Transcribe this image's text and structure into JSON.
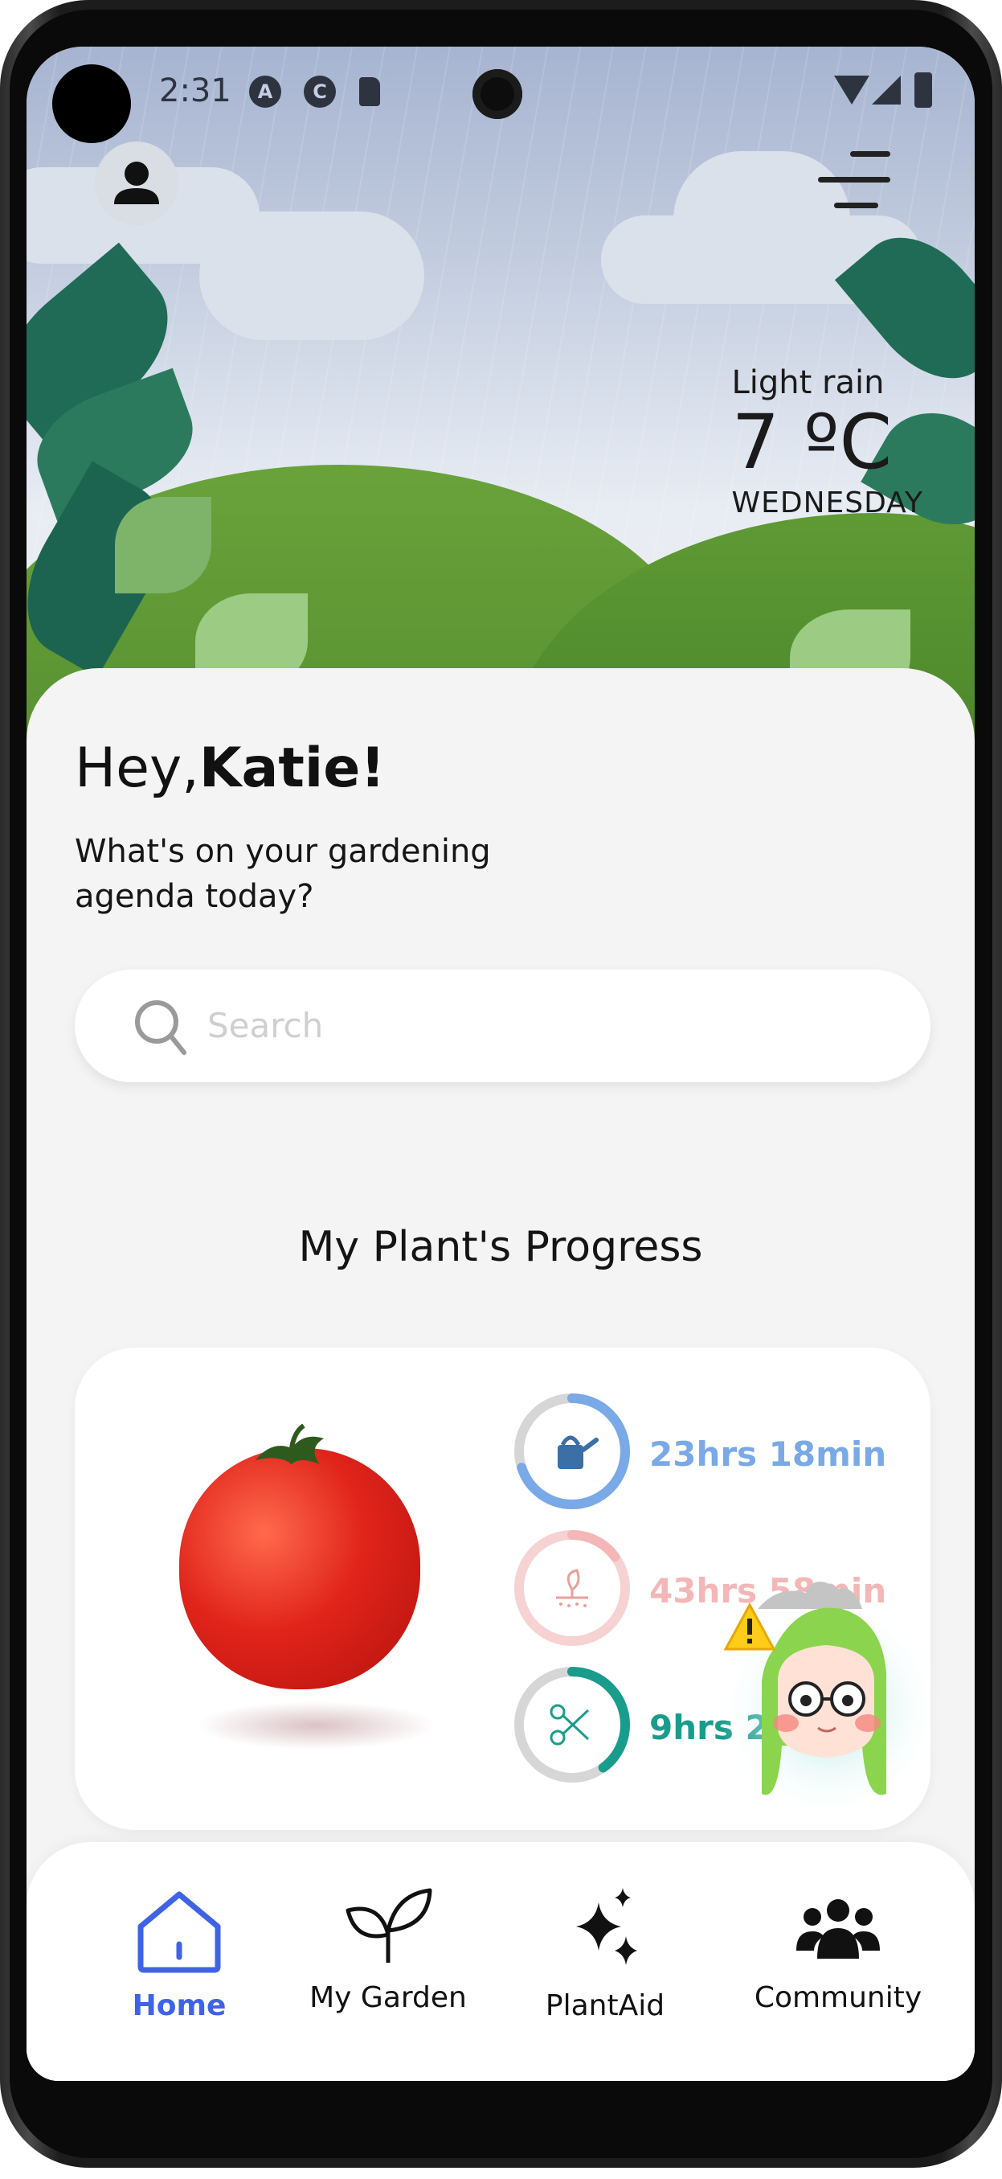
{
  "status_bar": {
    "time": "2:31"
  },
  "weather": {
    "condition": "Light rain",
    "temperature": "7 ºC",
    "day": "WEDNESDAY"
  },
  "greeting": {
    "hello": "Hey,",
    "name": "Katie!",
    "subtitle": "What's on your gardening agenda today?"
  },
  "search": {
    "placeholder": "Search"
  },
  "progress": {
    "title": "My Plant's Progress",
    "plant": "tomato",
    "metrics": [
      {
        "icon": "watering-can-icon",
        "value": "23hrs 18min",
        "color": "#79a9e6",
        "fraction": 0.7
      },
      {
        "icon": "fertilize-icon",
        "value": "43hrs 58min",
        "color": "#f4b6b6",
        "fraction": 0.15
      },
      {
        "icon": "pruning-scissors-icon",
        "value": "9hrs 2",
        "color": "#1a9c8c",
        "fraction": 0.4
      }
    ]
  },
  "nav": {
    "items": [
      {
        "label": "Home",
        "icon": "home-icon",
        "active": true
      },
      {
        "label": "My Garden",
        "icon": "sprout-icon",
        "active": false
      },
      {
        "label": "PlantAid",
        "icon": "sparkles-icon",
        "active": false
      },
      {
        "label": "Community",
        "icon": "community-icon",
        "active": false
      }
    ],
    "active_color": "#3f63e6"
  }
}
